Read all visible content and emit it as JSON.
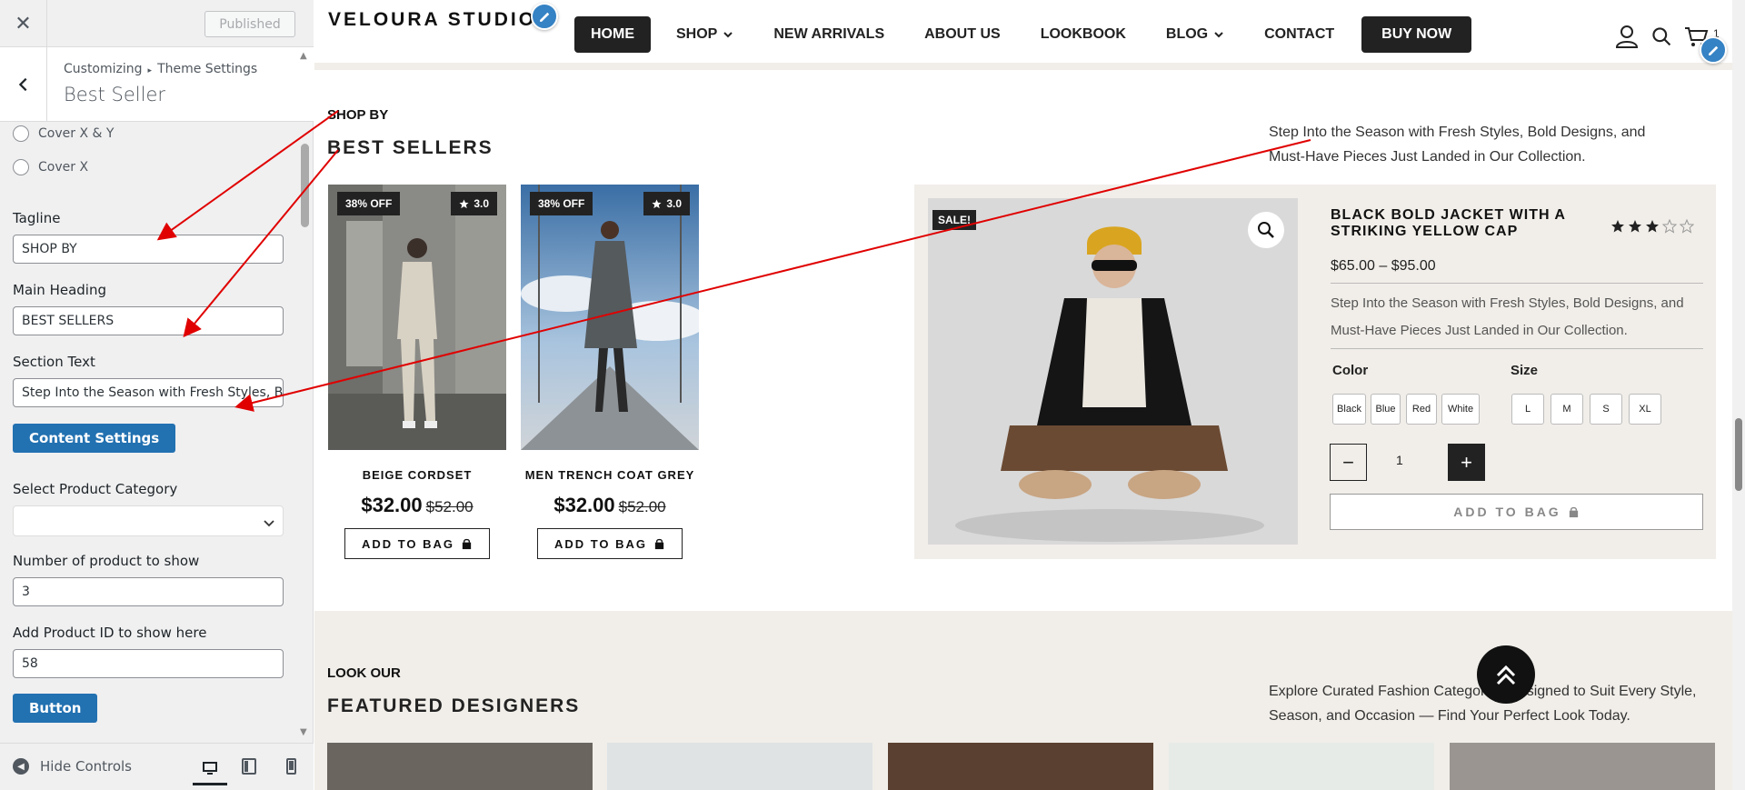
{
  "sidebar": {
    "publish_label": "Published",
    "breadcrumb_root": "Customizing",
    "breadcrumb_sep": "▸",
    "breadcrumb_parent": "Theme Settings",
    "section_title": "Best Seller",
    "radio_options": [
      "Cover X & Y",
      "Cover X"
    ],
    "tagline_label": "Tagline",
    "tagline_value": "SHOP BY",
    "heading_label": "Main Heading",
    "heading_value": "BEST SELLERS",
    "section_text_label": "Section Text",
    "section_text_value": "Step Into the Season with Fresh Styles, B",
    "content_settings_label": "Content Settings",
    "category_label": "Select Product Category",
    "category_value": "",
    "count_label": "Number of product to show",
    "count_value": "3",
    "product_id_label": "Add Product ID to show here",
    "product_id_value": "58",
    "button_label": "Button",
    "hide_controls_label": "Hide Controls"
  },
  "site": {
    "logo": "VELOURA STUDIO",
    "menu": {
      "home": "HOME",
      "shop": "SHOP",
      "new_arrivals": "NEW ARRIVALS",
      "about": "ABOUT US",
      "lookbook": "LOOKBOOK",
      "blog": "BLOG",
      "contact": "CONTACT",
      "buy_now": "BUY NOW"
    },
    "cart_count": "1",
    "best_sellers": {
      "tagline": "SHOP BY",
      "heading": "BEST SELLERS",
      "text": "Step Into the Season with Fresh Styles, Bold Designs, and Must-Have Pieces Just Landed in Our Collection.",
      "products": [
        {
          "discount": "38% OFF",
          "rating": "3.0",
          "name": "BEIGE CORDSET",
          "price": "$32.00",
          "old_price": "$52.00",
          "cta": "ADD TO BAG"
        },
        {
          "discount": "38% OFF",
          "rating": "3.0",
          "name": "MEN TRENCH COAT GREY",
          "price": "$32.00",
          "old_price": "$52.00",
          "cta": "ADD TO BAG"
        }
      ],
      "featured": {
        "sale_badge": "SALE!",
        "title": "BLACK BOLD JACKET WITH A STRIKING YELLOW CAP",
        "rating_value": 3,
        "rating_max": 5,
        "price": "$65.00 – $95.00",
        "description": "Step Into the Season with Fresh Styles, Bold Designs, and Must-Have Pieces Just Landed in Our Collection.",
        "color_label": "Color",
        "colors": [
          "Black",
          "Blue",
          "Red",
          "White"
        ],
        "size_label": "Size",
        "sizes": [
          "L",
          "M",
          "S",
          "XL"
        ],
        "qty": "1",
        "qty_minus": "−",
        "qty_plus": "+",
        "cta": "ADD TO BAG"
      }
    },
    "designers": {
      "tagline": "LOOK OUR",
      "heading": "FEATURED DESIGNERS",
      "text": "Explore Curated Fashion Categories Designed to Suit Every Style, Season, and Occasion — Find Your Perfect Look Today."
    },
    "colors": {
      "dark": "#222222",
      "accent_blue": "#2271b1",
      "beige_bg": "#f1eee9",
      "annotation_red": "#e00000"
    }
  }
}
